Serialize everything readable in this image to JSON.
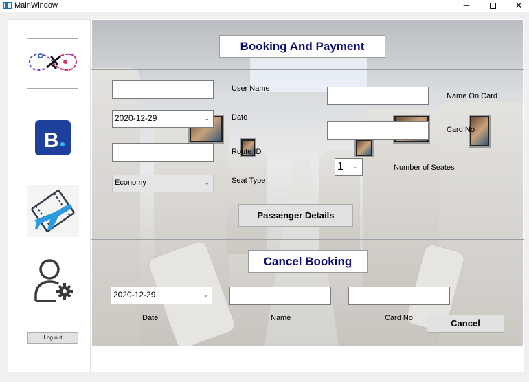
{
  "window": {
    "title": "MainWindow",
    "minimize_symbol": "─",
    "close_symbol": "✕"
  },
  "sidebar": {
    "icons": [
      "travel-route-icon",
      "booking-b-icon",
      "flight-ticket-icon",
      "user-settings-icon"
    ],
    "logout_label": "Log out",
    "booking_logo_letter": "B"
  },
  "booking": {
    "heading": "Booking And Payment",
    "user_name_label": "User Name",
    "user_name_value": "",
    "date_label": "Date",
    "date_value": "2020-12-29",
    "route_id_label": "Route ID",
    "route_id_value": "",
    "seat_type_label": "Seat Type",
    "seat_type_value": "Economy",
    "name_on_card_label": "Name On Card",
    "name_on_card_value": "",
    "card_no_label": "Card No",
    "card_no_value": "",
    "num_seats_label": "Number of Seates",
    "num_seats_value": "1",
    "passenger_details_label": "Passenger Details"
  },
  "cancel": {
    "heading": "Cancel Booking",
    "date_value": "2020-12-29",
    "date_label": "Date",
    "name_label": "Name",
    "name_value": "",
    "card_no_label": "Card No",
    "card_no_value": "",
    "cancel_button_label": "Cancel"
  },
  "colors": {
    "heading_text": "#0b0b6e",
    "booking_logo_bg": "#1f3f9c",
    "plane_icon": "#2d9be0"
  }
}
